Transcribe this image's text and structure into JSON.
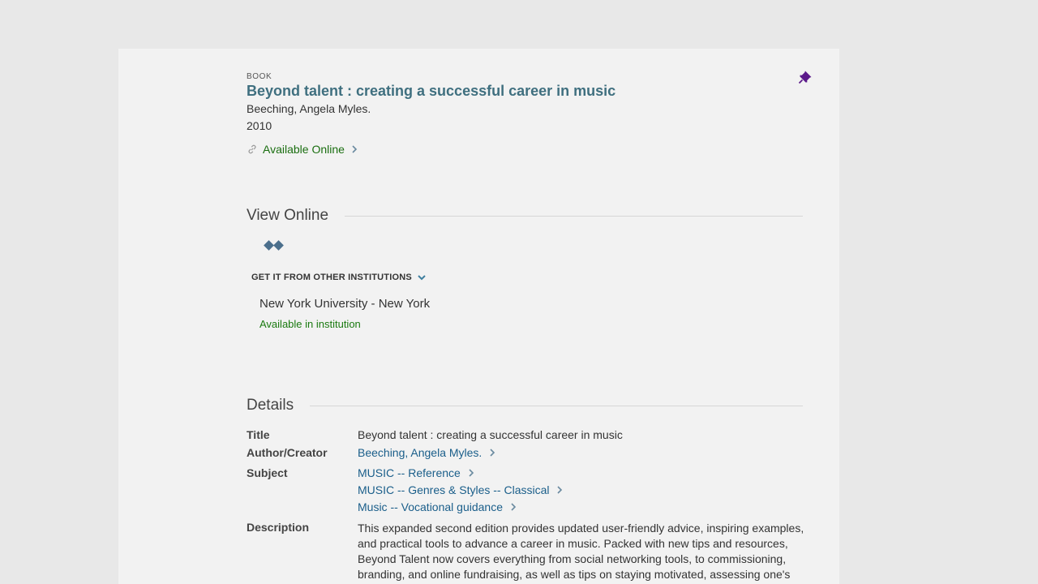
{
  "record": {
    "type": "BOOK",
    "title": "Beyond talent : creating a successful career in music",
    "creator": "Beeching, Angela Myles.",
    "year": "2010",
    "availability": "Available Online"
  },
  "view_online": {
    "heading": "View Online",
    "other_institutions_label": "GET IT FROM OTHER INSTITUTIONS",
    "institution": {
      "name": "New York University - New York",
      "status": "Available in institution"
    }
  },
  "details": {
    "heading": "Details",
    "title_label": "Title",
    "title_value": "Beyond talent : creating a successful career in music",
    "author_label": "Author/Creator",
    "author_value": "Beeching, Angela Myles.",
    "subject_label": "Subject",
    "subjects": [
      "MUSIC -- Reference",
      "MUSIC -- Genres & Styles -- Classical",
      "Music -- Vocational guidance"
    ],
    "description_label": "Description",
    "description_value": "This expanded second edition provides updated user-friendly advice, inspiring examples, and practical tools to advance a career in music. Packed with new tips and resources, Beyond Talent now covers everything from social networking tools, to commissioning, branding, and online fundraising, as well as tips on staying motivated, assessing one's"
  },
  "colors": {
    "title_link": "#3f6f7f",
    "available": "#1a6e10",
    "link": "#1a5e8a",
    "pin": "#5b1a8a"
  },
  "icons": {
    "pin": "pushpin-icon",
    "link": "link-icon",
    "chevron": "chevron-right-icon",
    "expand": "chevron-down-icon"
  }
}
